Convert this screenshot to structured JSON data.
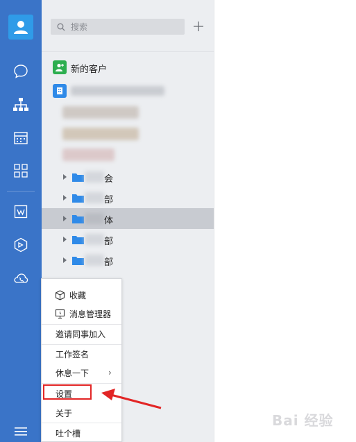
{
  "search": {
    "placeholder": "搜索"
  },
  "contacts": {
    "new_customer_label": "新的客户",
    "departments": [
      {
        "label": "会",
        "selected": false
      },
      {
        "label": "部",
        "selected": false
      },
      {
        "label": "体",
        "selected": true
      },
      {
        "label": "部",
        "selected": false
      },
      {
        "label": "部",
        "selected": false
      }
    ]
  },
  "menu": {
    "items": [
      {
        "label": "收藏",
        "icon": "cube-icon"
      },
      {
        "label": "消息管理器",
        "icon": "message-manager-icon"
      },
      {
        "label": "邀请同事加入"
      },
      {
        "label": "工作签名"
      },
      {
        "label": "休息一下",
        "chevron": "›"
      },
      {
        "label": "设置",
        "highlighted": true
      },
      {
        "label": "关于"
      },
      {
        "label": "吐个槽"
      }
    ]
  },
  "watermark": "Bai 经验",
  "colors": {
    "rail": "#3a74c8",
    "panel": "#eceef1",
    "selected_row": "#c8cbd1",
    "new_customer_icon": "#2dae4f",
    "folder": "#2f8ae8",
    "highlight": "#e22525"
  }
}
